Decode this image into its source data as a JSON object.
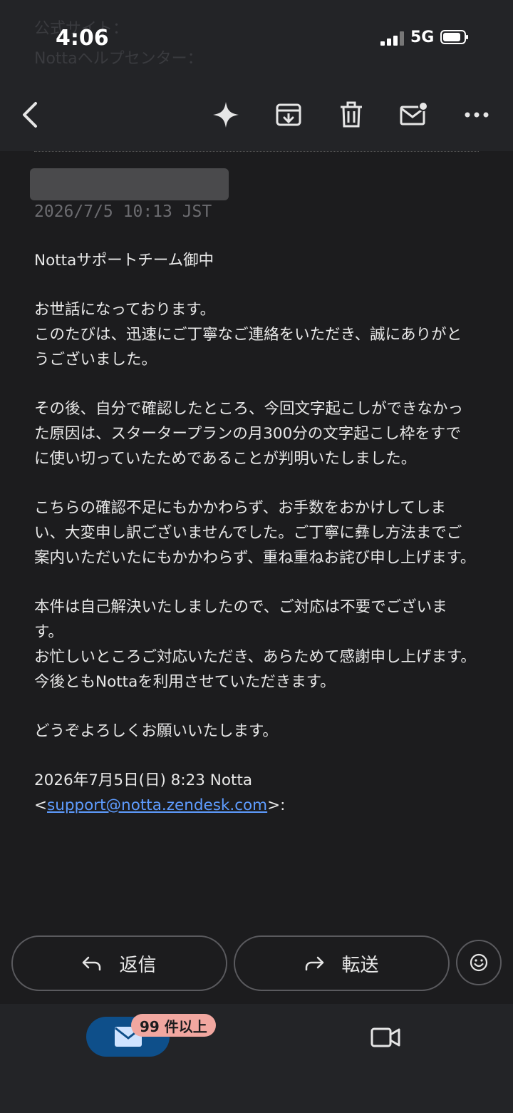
{
  "status_bar": {
    "time": "4:06",
    "network": "5G"
  },
  "background_header": {
    "line1": "公式サイト：",
    "line2": "Nottaヘルプセンター："
  },
  "email": {
    "timestamp": "2026/7/5 10:13 JST",
    "paragraphs": [
      "Nottaサポートチーム御中",
      "お世話になっております。\nこのたびは、迅速にご丁寧なご連絡をいただき、誠にありがとうございました。",
      "その後、自分で確認したところ、今回文字起こしができなかった原因は、スタータープランの月300分の文字起こし枠をすでに使い切っていたためであることが判明いたしました。",
      "こちらの確認不足にもかかわらず、お手数をおかけしてしまい、大変申し訳ございませんでした。ご丁寧に彝し方法までご案内いただいたにもかかわらず、重ね重ねお詫び申し上げます。",
      "本件は自己解決いたしましたので、ご対応は不要でございます。\nお忙しいところご対応いただき、あらためて感謝申し上げます。\n今後ともNottaを利用させていただきます。",
      "どうぞよろしくお願いいたします。"
    ],
    "quote_header": "2026年7月5日(日) 8:23 Notta",
    "quote_lt": "<",
    "quote_email": "support@notta.zendesk.com",
    "quote_gt": ">:"
  },
  "actions": {
    "reply_label": "返信",
    "forward_label": "転送"
  },
  "bottom_nav": {
    "mail_badge": "99 件以上"
  },
  "colors": {
    "background": "#1c1c1e",
    "bar": "#232427",
    "link": "#5e9cff",
    "mail_tab": "#0e4f8a",
    "badge": "#f1a7a0"
  }
}
